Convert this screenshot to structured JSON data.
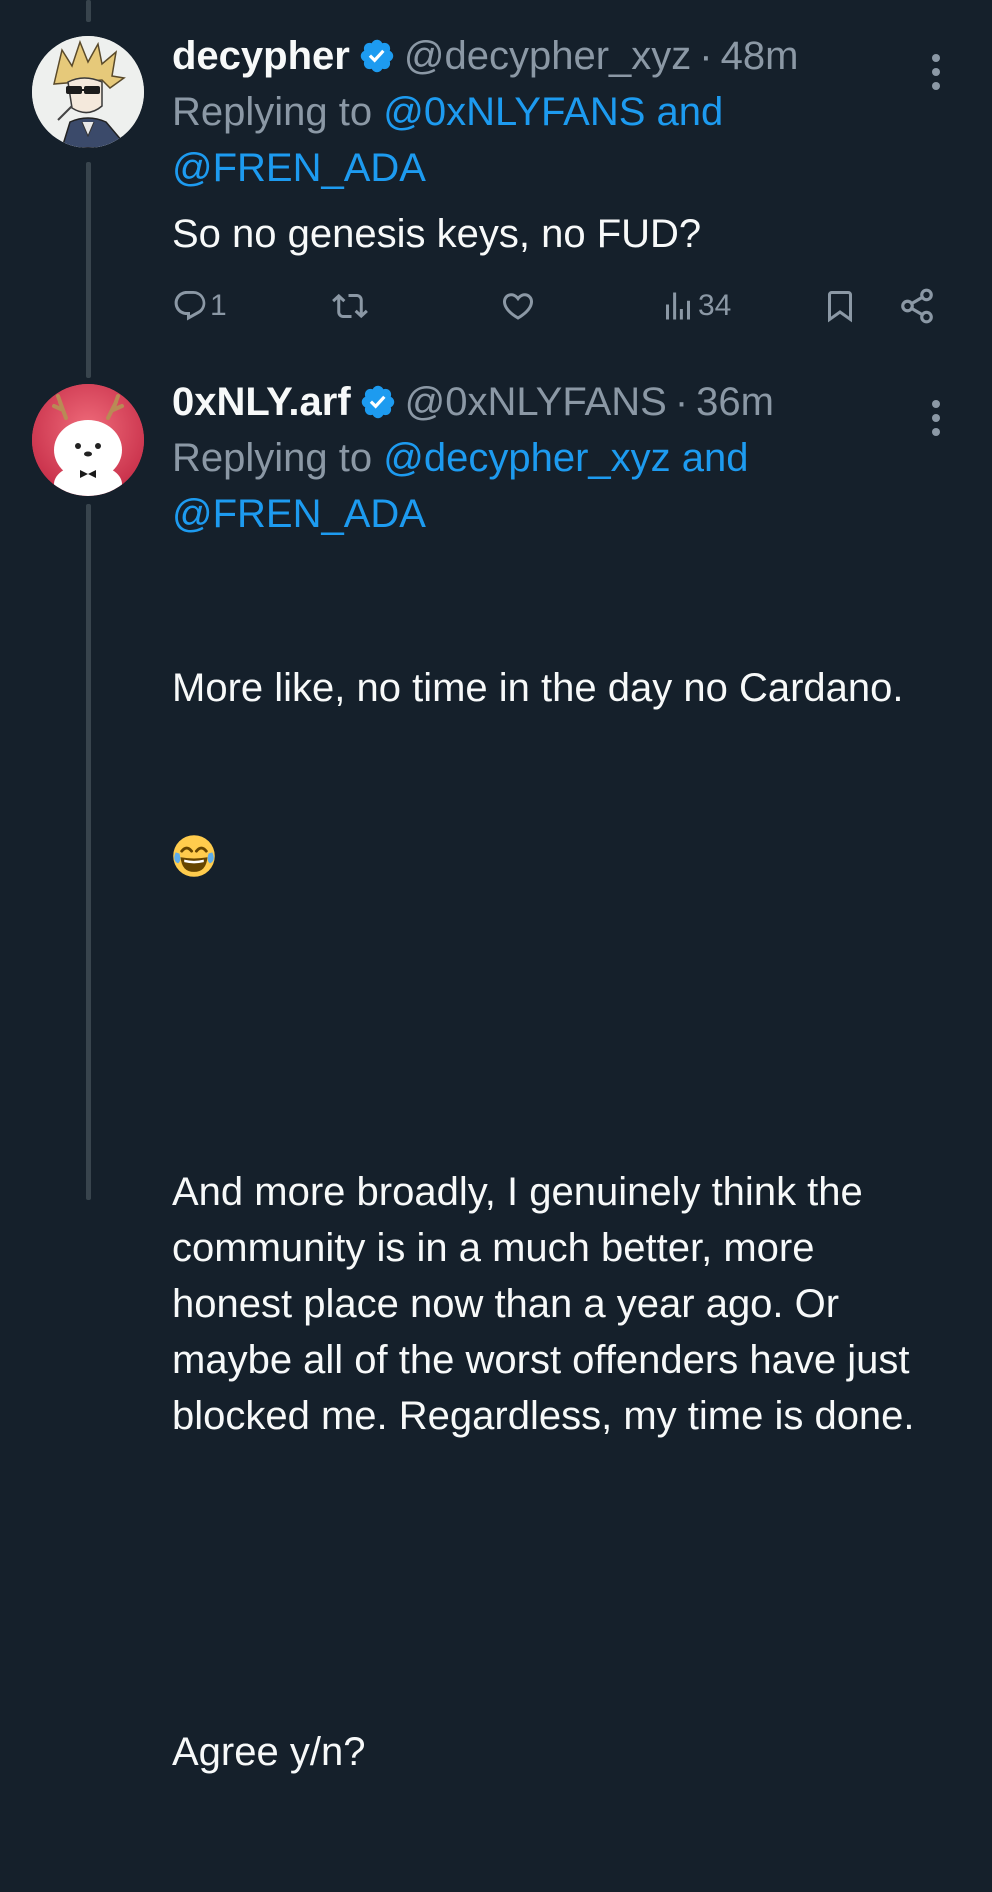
{
  "colors": {
    "background": "#15202b",
    "text": "#f7f9f9",
    "secondary": "#8b98a5",
    "accent": "#1d9bf0",
    "thread_line": "#38444d",
    "verified": "#1d9bf0"
  },
  "tweets": [
    {
      "display_name": "decypher",
      "handle": "@decypher_xyz",
      "separator": "·",
      "time": "48m",
      "replying_prefix": "Replying to",
      "mention_1": "@0xNLYFANS",
      "and_word": "and",
      "mention_2": "@FREN_ADA",
      "text": "So no genesis keys, no FUD?",
      "actions": {
        "reply_count": "1",
        "retweet_count": "",
        "like_count": "",
        "views_count": "34"
      },
      "icons": [
        "verified-badge-icon",
        "more-icon",
        "reply-icon",
        "retweet-icon",
        "like-icon",
        "views-icon",
        "bookmark-icon",
        "share-icon"
      ]
    },
    {
      "display_name": "0xNLY.arf",
      "handle": "@0xNLYFANS",
      "separator": "·",
      "time": "36m",
      "replying_prefix": "Replying to",
      "mention_1": "@decypher_xyz",
      "and_word": "and",
      "mention_2": "@FREN_ADA",
      "text_line_1": "More like, no time in the day no Cardano.",
      "emoji": "face-with-tears-of-joy",
      "text_paragraph_2": "And more broadly, I genuinely think the community is in a much better, more honest place now than a year ago. Or maybe all of the worst offenders have just blocked me. Regardless, my time is done.",
      "text_paragraph_3": "Agree y/n?"
    }
  ]
}
